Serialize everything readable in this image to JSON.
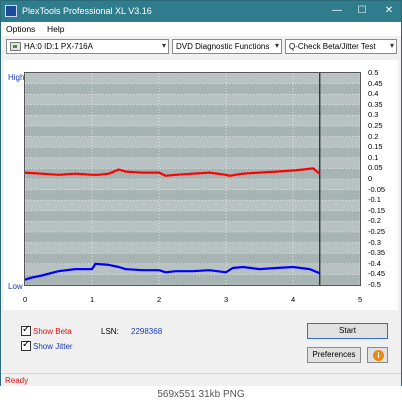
{
  "window": {
    "title": "PlexTools Professional XL V3.16",
    "minimize_glyph": "—",
    "maximize_glyph": "☐",
    "close_glyph": "✕"
  },
  "menu": {
    "options": "Options",
    "help": "Help"
  },
  "toolbar": {
    "drive": "HA:0 ID:1  PX-716A",
    "function": "DVD Diagnostic Functions",
    "test": "Q-Check Beta/Jitter Test",
    "dropdown_glyph": "▾"
  },
  "chart_data": {
    "type": "line",
    "left_axis_labels": {
      "high": "High",
      "low": "Low"
    },
    "x_ticks": [
      "0",
      "1",
      "2",
      "3",
      "4",
      "5"
    ],
    "xlim": [
      0,
      5
    ],
    "y_ticks": [
      "0.5",
      "0.45",
      "0.4",
      "0.35",
      "0.3",
      "0.25",
      "0.2",
      "0.15",
      "0.1",
      "0.05",
      "0",
      "-0.05",
      "-0.1",
      "-0.15",
      "-0.2",
      "-0.25",
      "-0.3",
      "-0.35",
      "-0.4",
      "-0.45",
      "-0.5"
    ],
    "ylim": [
      -0.5,
      0.5
    ],
    "marker_x": 4.4,
    "grid": true,
    "series": [
      {
        "name": "Beta",
        "color": "#ff0000",
        "x": [
          0,
          0.25,
          0.5,
          0.75,
          1.0,
          1.1,
          1.25,
          1.4,
          1.5,
          1.75,
          2.0,
          2.1,
          2.25,
          2.5,
          2.75,
          3.0,
          3.05,
          3.25,
          3.5,
          3.75,
          4.0,
          4.15,
          4.3,
          4.4
        ],
        "y": [
          0.03,
          0.025,
          0.02,
          0.025,
          0.02,
          0.02,
          0.025,
          0.045,
          0.035,
          0.03,
          0.03,
          0.015,
          0.02,
          0.025,
          0.03,
          0.02,
          0.015,
          0.025,
          0.03,
          0.035,
          0.04,
          0.045,
          0.05,
          0.025
        ]
      },
      {
        "name": "Jitter",
        "color": "#0000ff",
        "x": [
          0,
          0.1,
          0.25,
          0.5,
          0.75,
          1.0,
          1.05,
          1.25,
          1.4,
          1.5,
          1.75,
          2.0,
          2.1,
          2.25,
          2.5,
          2.75,
          3.0,
          3.1,
          3.25,
          3.5,
          3.75,
          4.0,
          4.25,
          4.4
        ],
        "y": [
          -0.475,
          -0.465,
          -0.455,
          -0.435,
          -0.425,
          -0.425,
          -0.4,
          -0.405,
          -0.415,
          -0.425,
          -0.43,
          -0.43,
          -0.44,
          -0.435,
          -0.435,
          -0.43,
          -0.44,
          -0.42,
          -0.415,
          -0.425,
          -0.42,
          -0.415,
          -0.425,
          -0.445
        ]
      }
    ]
  },
  "controls": {
    "show_beta": "Show Beta",
    "show_jitter": "Show Jitter",
    "lsn_label": "LSN:",
    "lsn_value": "2298368",
    "start": "Start",
    "preferences": "Preferences",
    "info_glyph": "i"
  },
  "status": "Ready",
  "caption": "569x551  31kb  PNG"
}
